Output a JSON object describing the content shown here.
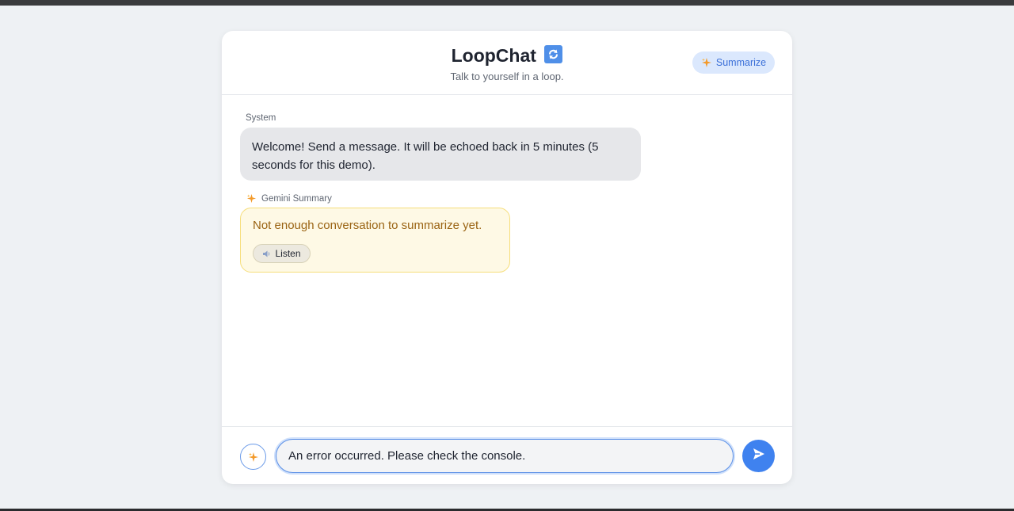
{
  "app": {
    "title": "LoopChat",
    "subtitle": "Talk to yourself in a loop.",
    "summarize_label": "Summarize"
  },
  "messages": [
    {
      "sender": "System",
      "text": "Welcome! Send a message. It will be echoed back in 5 minutes (5 seconds for this demo)."
    }
  ],
  "summary": {
    "label": "Gemini Summary",
    "text": "Not enough conversation to summarize yet.",
    "listen_label": "Listen"
  },
  "composer": {
    "value": "An error occurred. Please check the console."
  },
  "icons": {
    "loop": "repeat-icon",
    "spark": "sparkle-icon",
    "speaker": "speaker-icon",
    "send": "send-icon"
  },
  "colors": {
    "accent": "#3f82ef",
    "summary_text": "#9a6312",
    "summary_bg": "#fef9e5",
    "spark": "#f39a2b"
  }
}
